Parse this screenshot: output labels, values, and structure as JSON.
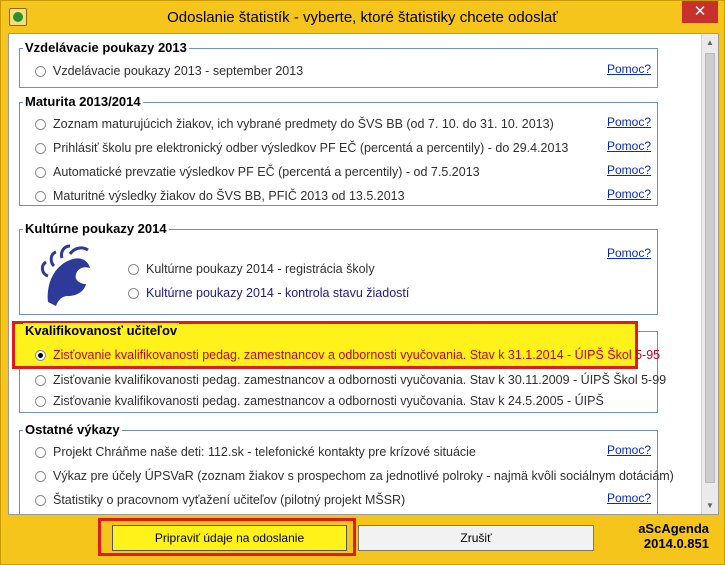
{
  "window": {
    "title": "Odoslanie štatistík - vyberte, ktoré štatistiky chcete odoslať",
    "close_label": "✕"
  },
  "groups": {
    "poukazy": {
      "title": "Vzdelávacie poukazy 2013",
      "items": [
        {
          "label": "Vzdelávacie poukazy 2013 - september 2013",
          "help": "Pomoc?"
        }
      ]
    },
    "maturita": {
      "title": "Maturita 2013/2014",
      "items": [
        {
          "label": "Zoznam maturujúcich žiakov, ich vybrané predmety do ŠVS BB (od 7. 10. do 31. 10. 2013)",
          "help": "Pomoc?"
        },
        {
          "label": "Prihlásiť školu pre elektronický odber výsledkov PF EČ (percentá a percentily) - do 29.4.2013",
          "help": "Pomoc?"
        },
        {
          "label": "Automatické prevzatie výsledkov PF EČ (percentá a percentily) - od 7.5.2013",
          "help": "Pomoc?"
        },
        {
          "label": "Maturitné výsledky žiakov do ŠVS BB, PFIČ 2013 od 13.5.2013",
          "help": "Pomoc?"
        }
      ]
    },
    "kulturne": {
      "title": "Kultúrne poukazy 2014",
      "items": [
        {
          "label": "Kultúrne poukazy 2014 - registrácia školy",
          "help": "Pomoc?"
        },
        {
          "label": "Kultúrne poukazy 2014 - kontrola stavu žiadostí",
          "help": ""
        }
      ]
    },
    "kvalifikovanost": {
      "title": "Kvalifikovanosť učiteľov",
      "items": [
        {
          "label": "Zisťovanie kvalifikovanosti pedag. zamestnancov a odbornosti vyučovania. Stav k 31.1.2014 - ÚIPŠ Škol 5-95",
          "selected": true
        },
        {
          "label": "Zisťovanie kvalifikovanosti pedag. zamestnancov a odbornosti vyučovania. Stav k 30.11.2009 - ÚIPŠ Škol 5-99"
        },
        {
          "label": "Zisťovanie kvalifikovanosti pedag. zamestnancov a odbornosti vyučovania. Stav k 24.5.2005 - ÚIPŠ"
        }
      ]
    },
    "ostatne": {
      "title": "Ostatné výkazy",
      "items": [
        {
          "label": "Projekt Chráňme naše deti: 112.sk - telefonické kontakty pre krízové situácie",
          "help": "Pomoc?"
        },
        {
          "label": "Výkaz pre účely ÚPSVaR (zoznam žiakov s prospechom za jednotlivé polroky - najmä kvôli sociálnym dotáciám)"
        },
        {
          "label": "Štatistiky o pracovnom vyťažení učiteľov (pilotný projekt MŠSR)",
          "help": "Pomoc?"
        }
      ]
    }
  },
  "buttons": {
    "prepare": "Pripraviť údaje na odoslanie",
    "cancel": "Zrušiť"
  },
  "brand": {
    "name": "aScAgenda",
    "version": "2014.0.851"
  }
}
